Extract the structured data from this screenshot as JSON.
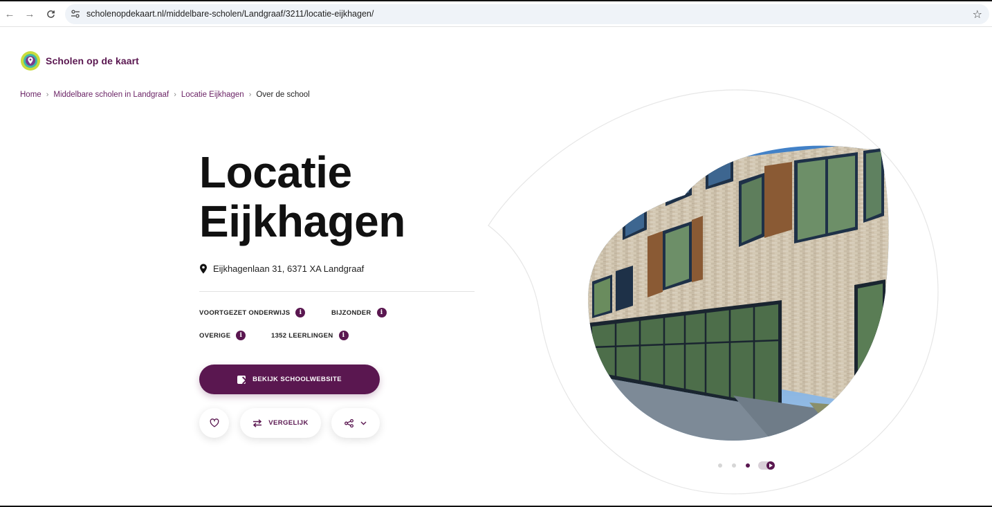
{
  "browser": {
    "url": "scholenopdekaart.nl/middelbare-scholen/Landgraaf/3211/locatie-eijkhagen/"
  },
  "site": {
    "logo_text": "Scholen op de kaart",
    "brand_color": "#5a1750"
  },
  "breadcrumb": {
    "items": [
      "Home",
      "Middelbare scholen in Landgraaf",
      "Locatie Eijkhagen"
    ],
    "current": "Over de school"
  },
  "school": {
    "name_line1": "Locatie",
    "name_line2": "Eijkhagen",
    "address": "Eijkhagenlaan 31, 6371 XA Landgraaf",
    "tags": [
      "VOORTGEZET ONDERWIJS",
      "BIJZONDER",
      "OVERIGE",
      "1352 LEERLINGEN"
    ]
  },
  "actions": {
    "website_label": "BEKIJK SCHOOLWEBSITE",
    "compare_label": "VERGELIJK",
    "favorite_icon": "heart-icon",
    "share_icon": "share-icon"
  },
  "carousel": {
    "slide_count": 3,
    "active_slide": 3
  }
}
